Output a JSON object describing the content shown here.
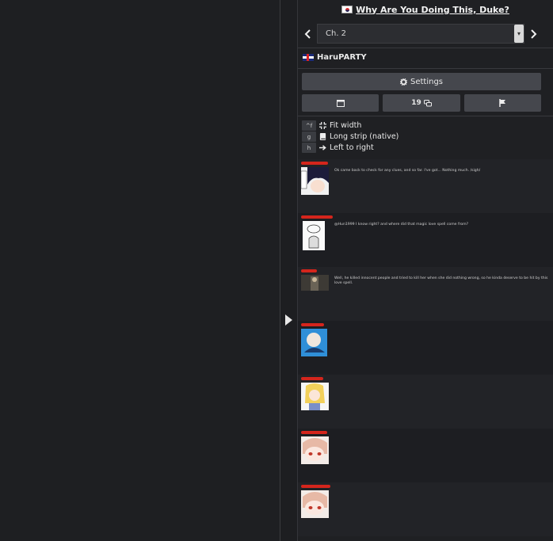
{
  "manga": {
    "title": "Why Are You Doing This, Duke?",
    "origin_flag": "south-korea-flag"
  },
  "chapter": {
    "selected": "Ch. 2"
  },
  "group": {
    "name": "HaruPARTY",
    "flag": "uk-flag"
  },
  "buttons": {
    "settings_label": "Settings",
    "comments_count": "19"
  },
  "shortcuts": [
    {
      "key": "^f",
      "label": "Fit width",
      "icon": "compress-icon"
    },
    {
      "key": "g",
      "label": "Long strip (native)",
      "icon": "book-icon"
    },
    {
      "key": "h",
      "label": "Left to right",
      "icon": "arrow-right-icon"
    }
  ],
  "comments": [
    {
      "text": "Ok came back to check for any clues, and so far. I've got... Nothing much. /sigh/"
    },
    {
      "text": "@Hun1999 I know right? and where did that magic love spell come from?"
    },
    {
      "text": "Well, he killed innocent people and tried to kill her when she did nothing wrong, so he kinda deserve to be hit by this love spell."
    },
    {
      "text": ""
    },
    {
      "text": ""
    },
    {
      "text": ""
    },
    {
      "text": ""
    }
  ],
  "colors": {
    "accent_red": "#d4251c",
    "panel": "#1f2023",
    "button": "#45474d"
  }
}
